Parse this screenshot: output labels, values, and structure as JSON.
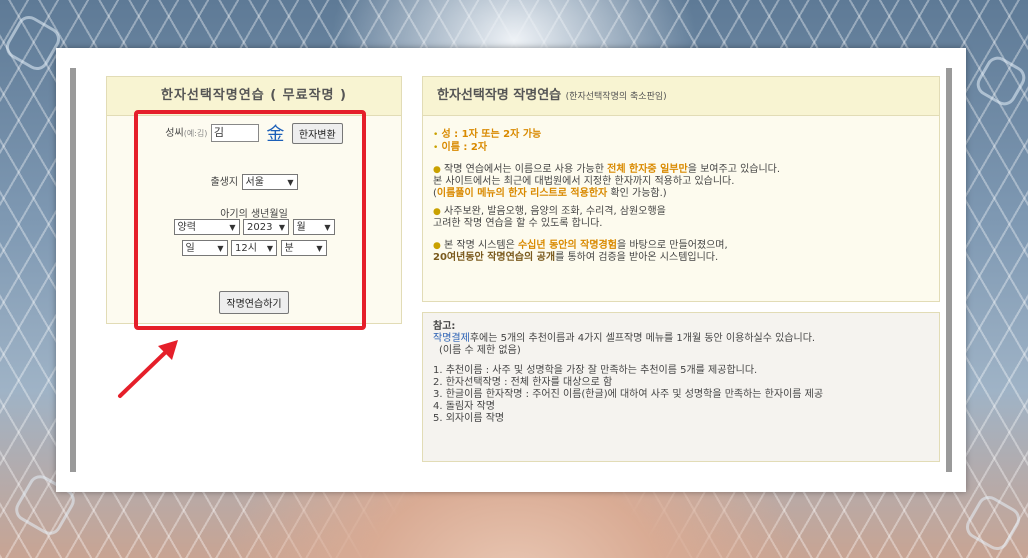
{
  "left": {
    "title": "한자선택작명연습 ( 무료작명 )",
    "surname_label": "성씨",
    "surname_hint": "(예:김)",
    "surname_value": "김",
    "hanja_glyph": "金",
    "convert_button": "한자변환",
    "birthplace_label": "출생지",
    "birthplace_value": "서울",
    "birthdate_label": "아기의 생년월일",
    "calendar_value": "양력",
    "year_value": "2023",
    "month_value": "월",
    "day_value": "일",
    "hour_value": "12시",
    "minute_value": "분",
    "submit_button": "작명연습하기"
  },
  "right_top": {
    "title": "한자선택작명 작명연습",
    "subtitle": "(한자선택작명의 축소판임)",
    "rule1": "성 : 1자 또는 2자 가능",
    "rule2": "이름 : 2자",
    "p1a": "작명 연습에서는 이름으로 사용 가능한 ",
    "p1b": "전체 한자중 일부만",
    "p1c": "을 보여주고 있습니다.",
    "p1d": "본 사이트에서는 최근에 대법원에서 지정한 한자까지 적용하고 있습니다.",
    "p1e_open": "(",
    "p1e_em": "이름풀이 메뉴의 한자 리스트로 적용한자",
    "p1e_rest": " 확인 가능함.)",
    "p2a": "사주보완, 발음오행, 음양의 조화, 수리격, 삼원오행을",
    "p2b": "고려한 작명 연습을 할 수 있도록 합니다.",
    "p3a": "본 작명 시스템은 ",
    "p3b": "수십년 동안의 작명경험",
    "p3c": "을 바탕으로 만들어졌으며,",
    "p3d": "20여년동안 작명연습의 공개",
    "p3e": "를 통하여 검증을 받아온 시스템입니다."
  },
  "right_bottom": {
    "heading": "참고:",
    "link": "작명결제",
    "intro": "후에는 5개의 추천이름과 4가지 셀프작명 메뉴를 1개월 동안 이용하실수 있습니다.",
    "intro2": "(이름 수 제한 없음)",
    "items": [
      "1. 추천이름 : 사주 및 성명학을 가장 잘 만족하는 추천이름 5개를 제공합니다.",
      "2. 한자선택작명 : 전체 한자를 대상으로 함",
      "3. 한글이름 한자작명 : 주어진 이름(한글)에 대하여 사주 및 성명학을 만족하는 한자이름 제공",
      "4. 돌림자 작명",
      "5. 외자이름 작명"
    ]
  },
  "colors": {
    "highlight": "#e51f2a",
    "arrow": "#e51f2a"
  }
}
